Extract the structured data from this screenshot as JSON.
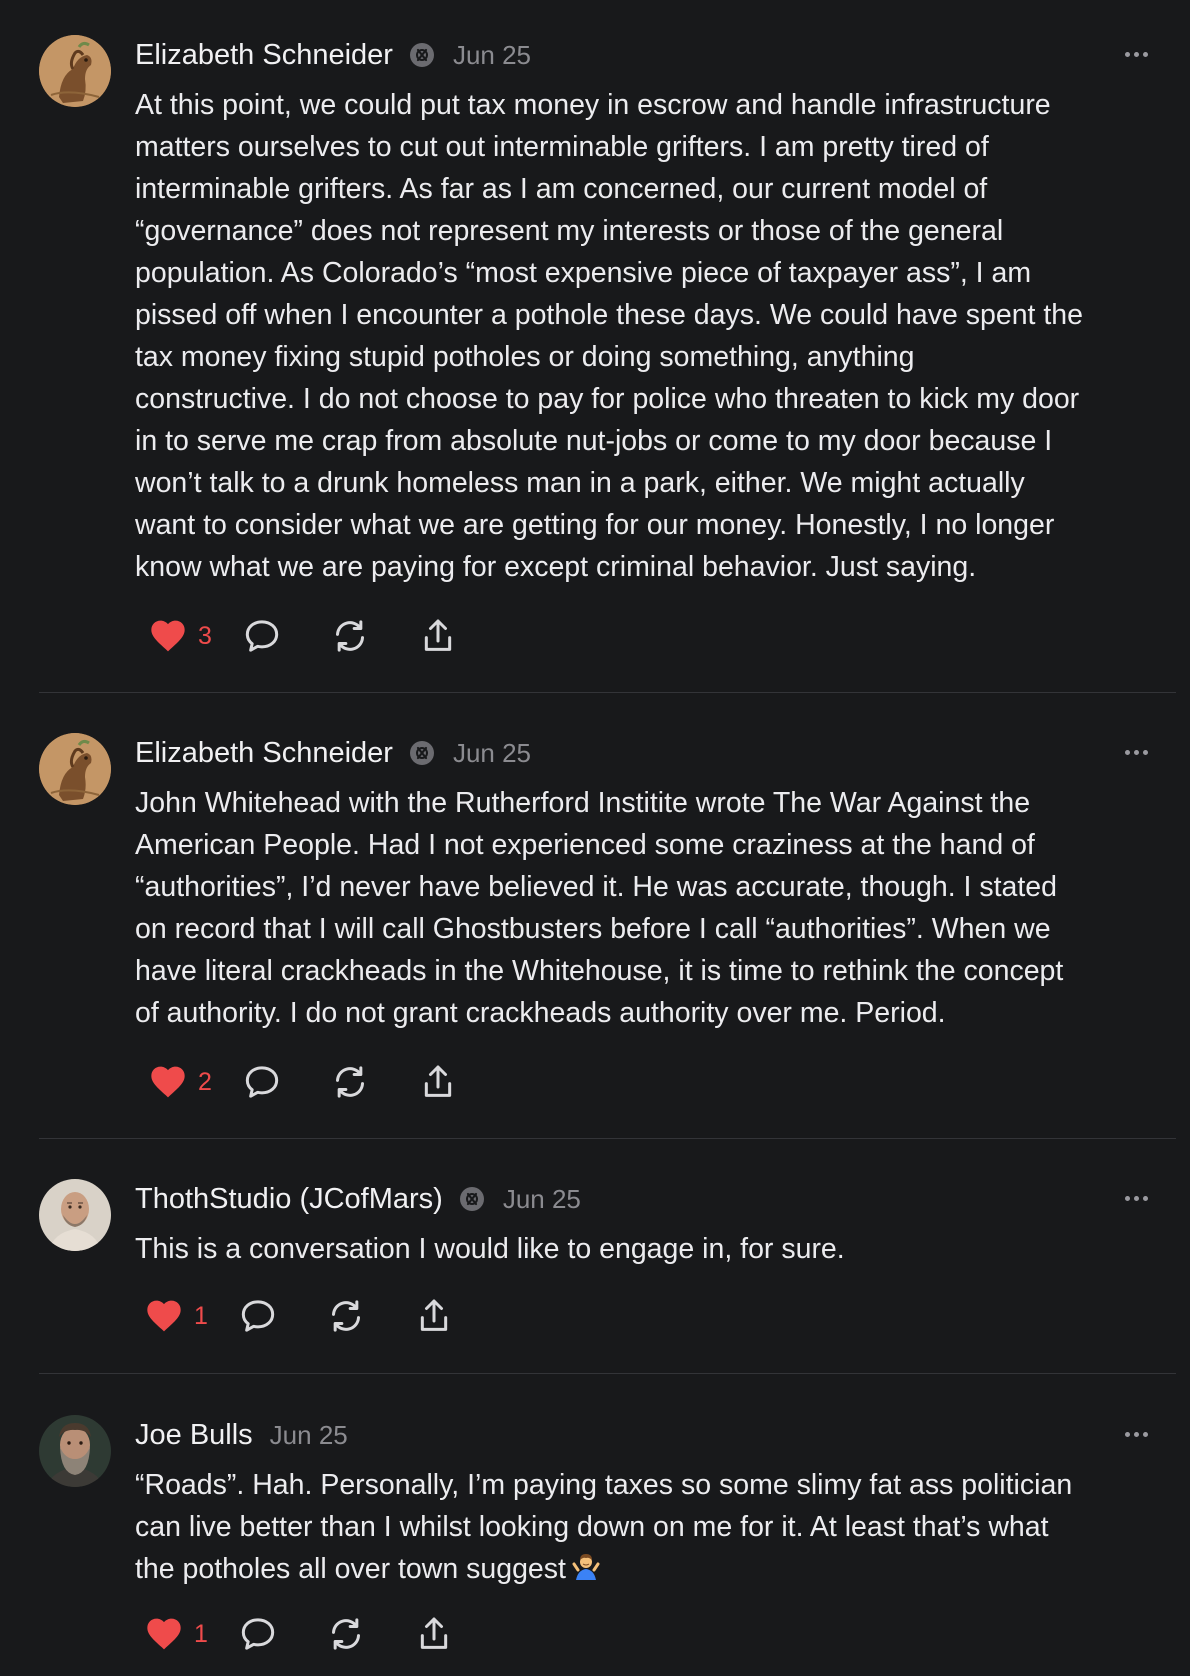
{
  "posts": [
    {
      "author": "Elizabeth Schneider",
      "date": "Jun 25",
      "text": "At this point, we could put tax money in escrow and handle infrastructure\nmatters ourselves to cut out interminable grifters. I am pretty tired of\ninterminable grifters. As far as I am concerned, our current model of\n“governance” does not represent my interests or those of the general\npopulation. As Colorado’s “most expensive piece of taxpayer ass”, I am\npissed off when I encounter a pothole these days. We could have spent the\ntax money fixing stupid potholes or doing something, anything\nconstructive. I do not choose to pay for police who threaten to kick my door\nin to serve me crap from absolute nut-jobs or come to my door because I\nwon’t talk to a drunk homeless man in a park, either. We might actually\nwant to consider what we are getting for our money. Honestly, I no longer\nknow what we are paying for except criminal behavior. Just saying.",
      "likes": "3",
      "avatar_icon": "horse-avatar",
      "badge_icon": "verified-badge-icon"
    },
    {
      "author": "Elizabeth Schneider",
      "date": "Jun 25",
      "text": "John Whitehead with the Rutherford Institite wrote The War Against the\nAmerican People. Had I not experienced some craziness at the hand of\n“authorities”, I’d never have believed it. He was accurate, though. I stated\non record that I will call Ghostbusters before I call “authorities”. When we\nhave literal crackheads in the Whitehouse, it is time to rethink the concept\nof authority. I do not grant crackheads authority over me. Period.",
      "likes": "2",
      "avatar_icon": "horse-avatar",
      "badge_icon": "verified-badge-icon"
    },
    {
      "author": "ThothStudio (JCofMars)",
      "date": "Jun 25",
      "text": "This is a conversation I would like to engage in, for sure.",
      "likes": "1",
      "avatar_icon": "bald-man-avatar",
      "badge_icon": "verified-badge-icon"
    },
    {
      "author": "Joe Bulls",
      "date": "Jun 25",
      "text": "“Roads”. Hah. Personally, I’m paying taxes so some slimy fat ass politician\ncan live better than I whilst looking down on me for it. At least that’s what\nthe potholes all over town suggest",
      "likes": "1",
      "avatar_icon": "bearded-man-avatar",
      "emoji": "person-shrugging-emoji"
    }
  ],
  "colors": {
    "background": "#18191b",
    "like": "#ef4b4b",
    "muted": "#8b8b90",
    "divider": "#333438"
  }
}
